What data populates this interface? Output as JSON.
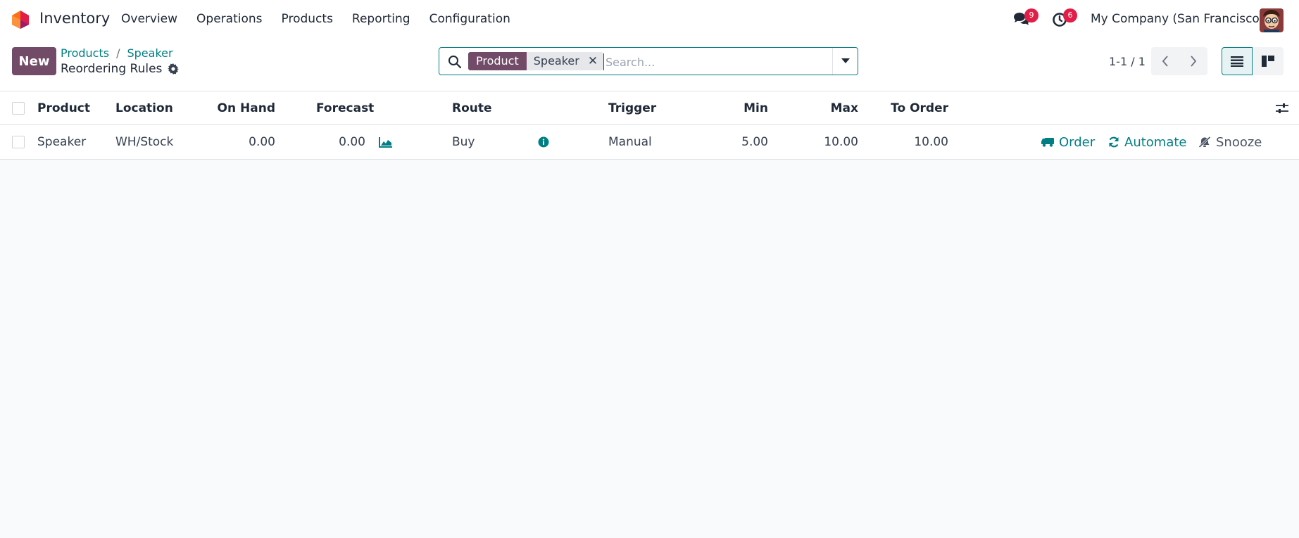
{
  "app": {
    "name": "Inventory",
    "menu": [
      "Overview",
      "Operations",
      "Products",
      "Reporting",
      "Configuration"
    ],
    "messages_count": "9",
    "activities_count": "6",
    "company": "My Company (San Francisco)",
    "brand_color": "#714b67",
    "accent_color": "#017e84"
  },
  "control": {
    "new_label": "New",
    "breadcrumb": [
      "Products",
      "Speaker"
    ],
    "breadcrumb_separator": "/",
    "current": "Reordering Rules",
    "search": {
      "facet_label": "Product",
      "facet_value": "Speaker",
      "placeholder": "Search..."
    },
    "pager": "1-1 / 1"
  },
  "table": {
    "headers": {
      "product": "Product",
      "location": "Location",
      "on_hand": "On Hand",
      "forecast": "Forecast",
      "route": "Route",
      "trigger": "Trigger",
      "min": "Min",
      "max": "Max",
      "to_order": "To Order"
    },
    "rows": [
      {
        "product": "Speaker",
        "location": "WH/Stock",
        "on_hand": "0.00",
        "forecast": "0.00",
        "route": "Buy",
        "trigger": "Manual",
        "min": "5.00",
        "max": "10.00",
        "to_order": "10.00",
        "actions": {
          "order": "Order",
          "automate": "Automate",
          "snooze": "Snooze"
        }
      }
    ]
  }
}
